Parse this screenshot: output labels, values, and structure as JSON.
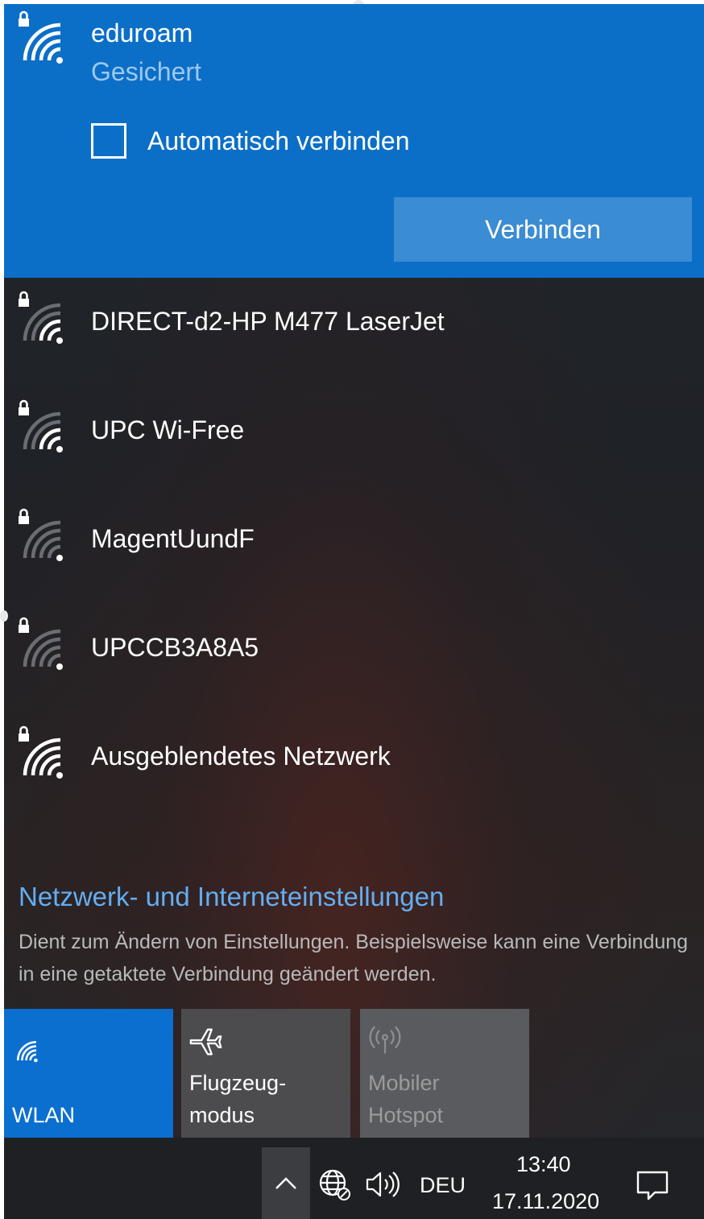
{
  "selected_network": {
    "name": "eduroam",
    "status": "Gesichert",
    "auto_connect_label": "Automatisch verbinden",
    "auto_connect_checked": false,
    "connect_button": "Verbinden",
    "icon": "wifi-secured-icon"
  },
  "networks": [
    {
      "name": "DIRECT-d2-HP M477 LaserJet",
      "icon": "wifi-secured-icon",
      "signal": "medium"
    },
    {
      "name": "UPC Wi-Free",
      "icon": "wifi-secured-icon",
      "signal": "medium"
    },
    {
      "name": "MagentUundF",
      "icon": "wifi-secured-icon",
      "signal": "weak"
    },
    {
      "name": "UPCCB3A8A5",
      "icon": "wifi-secured-icon",
      "signal": "weak"
    },
    {
      "name": "Ausgeblendetes Netzwerk",
      "icon": "wifi-secured-icon",
      "signal": "full"
    }
  ],
  "settings": {
    "link": "Netzwerk- und Interneteinstellungen",
    "description": "Dient zum Ändern von Einstellungen. Beispielsweise kann eine Verbindung in eine getaktete Verbindung geändert werden."
  },
  "quick_actions": [
    {
      "label": "WLAN",
      "icon": "wifi-icon",
      "active": true
    },
    {
      "label": "Flugzeug-\nmodus",
      "icon": "airplane-icon",
      "active": false
    },
    {
      "label": "Mobiler\nHotspot",
      "icon": "hotspot-icon",
      "disabled": true
    }
  ],
  "taskbar": {
    "language": "DEU",
    "time": "13:40",
    "date": "17.11.2020"
  },
  "colors": {
    "accent": "#0c6fc7",
    "link": "#62aef2",
    "flyout_background": "#1f2227"
  }
}
